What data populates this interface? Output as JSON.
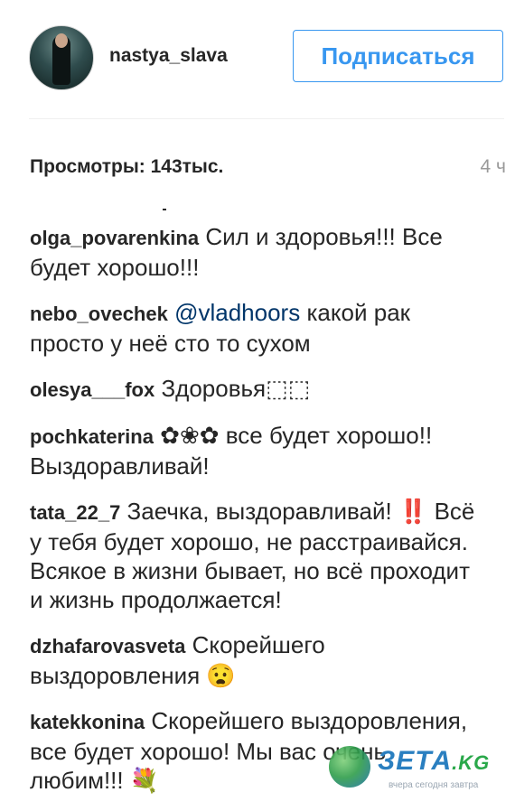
{
  "header": {
    "username": "nastya_slava",
    "follow_label": "Подписаться"
  },
  "post": {
    "views": "Просмотры: 143тыс.",
    "time": "4 ч"
  },
  "comments": [
    {
      "user": "olga_povarenkina",
      "text": "Сил и здоровья!!! Все будет хорошо!!!"
    },
    {
      "user": "nebo_ovechek",
      "mention": "@vladhoors",
      "text": "какой рак просто у неё сто то сухом"
    },
    {
      "user": "olesya___fox",
      "text": "Здоровья⬚⬚"
    },
    {
      "user": "pochkaterina",
      "text": "✿❀✿ все будет хорошо!! Выздоравливай!"
    },
    {
      "user": "tata_22_7",
      "text": "Заечка, выздоравливай! ‼️ Всё у тебя будет хорошо, не расстраивайся. Всякое в жизни бывает, но всё проходит и жизнь продолжается!"
    },
    {
      "user": "dzhafarovasveta",
      "text": "Скорейшего выздоровления 😧"
    },
    {
      "user": "katekkonina",
      "text": "Скорейшего выздоровления, все будет хорошо! Мы вас очень любим!!! 💐"
    }
  ],
  "watermark": {
    "brand": "ЗЕТА",
    "suffix": ".KG",
    "tagline": "вчера сегодня завтра"
  }
}
